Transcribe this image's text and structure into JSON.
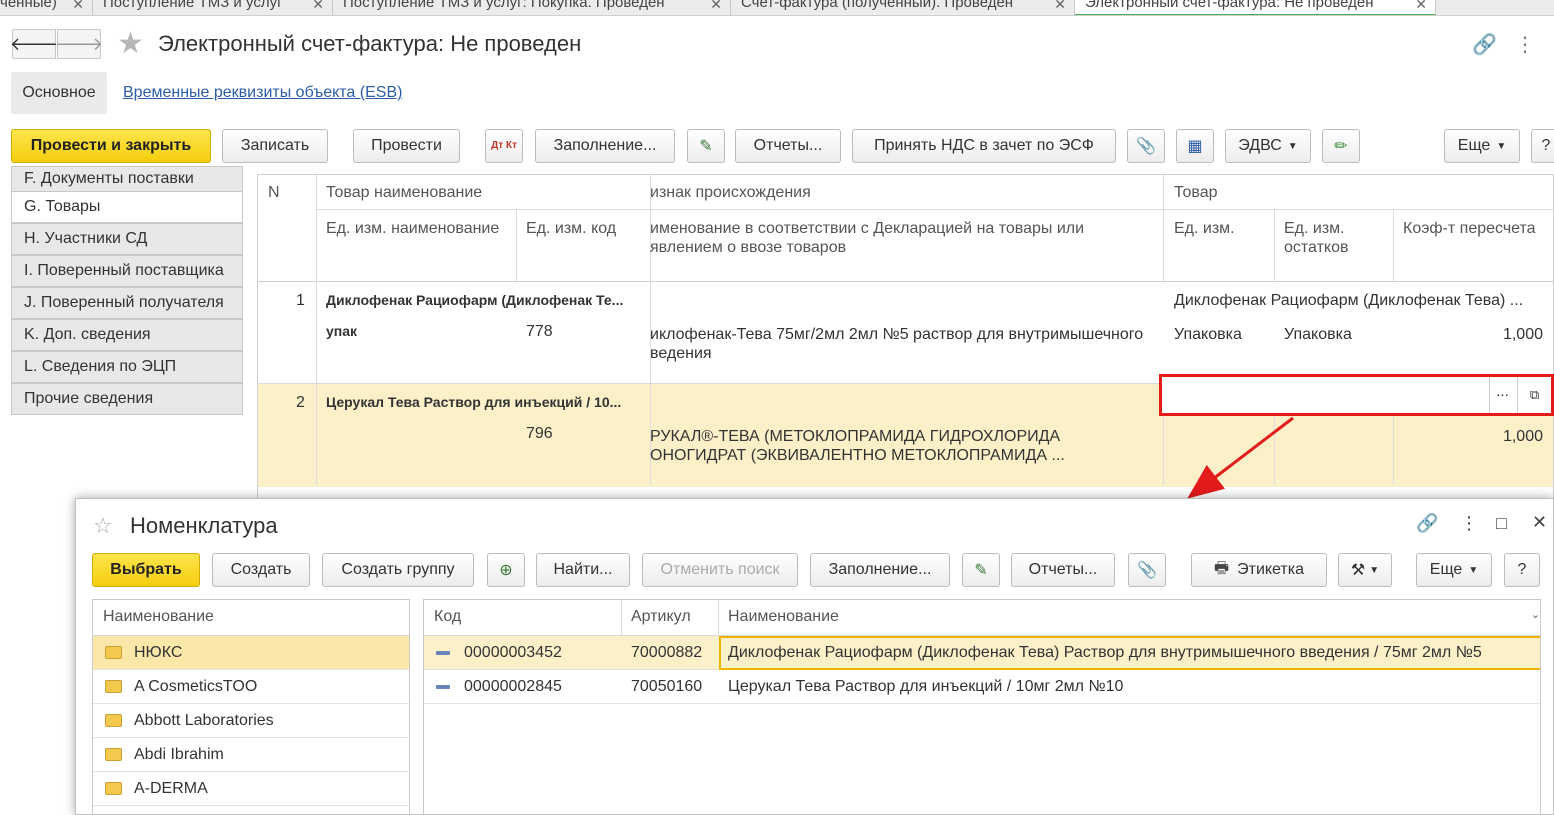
{
  "tabs": [
    {
      "label": "ченные)"
    },
    {
      "label": "Поступление ТМЗ и услуг"
    },
    {
      "label": "Поступление ТМЗ и услуг: Покупка. Проведен"
    },
    {
      "label": "Счет-фактура (полученный). Проведен"
    },
    {
      "label": "Электронный счет-фактура:  Не проведен"
    }
  ],
  "header": {
    "title": "Электронный счет-фактура:  Не проведен",
    "tab_main": "Основное",
    "tab_esb": "Временные реквизиты объекта (ESB)"
  },
  "toolbar": {
    "post_close": "Провести и закрыть",
    "save": "Записать",
    "post": "Провести",
    "dtkt": "Дт Кт",
    "fill": "Заполнение...",
    "reports": "Отчеты...",
    "accept_vat": "Принять НДС в зачет по ЭСФ",
    "edvs": "ЭДВС",
    "more": "Еще",
    "help": "?"
  },
  "side_menu": [
    {
      "label": "F. Документы поставки"
    },
    {
      "label": "G. Товары"
    },
    {
      "label": "H. Участники СД"
    },
    {
      "label": "I. Поверенный поставщика"
    },
    {
      "label": "J. Поверенный получателя"
    },
    {
      "label": "K. Доп. сведения"
    },
    {
      "label": "L. Сведения по ЭЦП"
    },
    {
      "label": "Прочие сведения"
    }
  ],
  "grid": {
    "headers": {
      "n": "N",
      "name": "Товар наименование",
      "origin": "изнак происхождения",
      "product": "Товар",
      "unit_name": "Ед. изм. наименование",
      "unit_code": "Ед. изм. код",
      "decl_name_1": "именование в соответствии с Декларацией  на товары или",
      "decl_name_2": "явлением о ввозе товаров",
      "unit": "Ед. изм.",
      "unit_rest_1": "Ед. изм.",
      "unit_rest_2": "остатков",
      "coef": "Коэф-т пересчета"
    },
    "rows": [
      {
        "n": "1",
        "name": "Диклофенак Рациофарм (Диклофенак Те...",
        "unit_name": "упак",
        "unit_code": "778",
        "decl_1": "иклофенак-Тева 75мг/2мл 2мл №5 раствор для внутримышечного",
        "decl_2": "ведения",
        "product": "Диклофенак Рациофарм (Диклофенак Тева) ...",
        "unit": "Упаковка",
        "unit_rest": "Упаковка",
        "coef": "1,000"
      },
      {
        "n": "2",
        "name": "Церукал Тева Раствор для инъекций / 10...",
        "unit_name": "",
        "unit_code": "796",
        "decl_1": "РУКАЛ®-ТЕВА (МЕТОКЛОПРАМИДА ГИДРОХЛОРИДА",
        "decl_2": "ОНОГИДРАТ (ЭКВИВАЛЕНТНО МЕТОКЛОПРАМИДА ...",
        "product": "",
        "unit": "",
        "unit_rest": "",
        "coef": "1,000"
      }
    ],
    "edit_dots": "..."
  },
  "popup": {
    "title": "Номенклатура",
    "buttons": {
      "select": "Выбрать",
      "create": "Создать",
      "create_group": "Создать группу",
      "find": "Найти...",
      "cancel_search": "Отменить поиск",
      "fill": "Заполнение...",
      "reports": "Отчеты...",
      "label": "Этикетка",
      "more": "Еще",
      "help": "?"
    },
    "tree_header": "Наименование",
    "tree": [
      {
        "label": "НЮКС"
      },
      {
        "label": "A CosmeticsTOO"
      },
      {
        "label": "Abbott Laboratories"
      },
      {
        "label": "Abdi Ibrahim"
      },
      {
        "label": "A-DERMA"
      }
    ],
    "list_headers": {
      "code": "Код",
      "article": "Артикул",
      "name": "Наименование"
    },
    "list": [
      {
        "code": "00000003452",
        "article": "70000882",
        "name": "Диклофенак Рациофарм (Диклофенак Тева) Раствор для внутримышечного введения / 75мг 2мл №5"
      },
      {
        "code": "00000002845",
        "article": "70050160",
        "name": "Церукал Тева Раствор для инъекций / 10мг 2мл №10"
      }
    ]
  },
  "colors": {
    "primary": "#f4ce0d",
    "highlight": "#e31b1b",
    "selection": "#fbf0c8",
    "link": "#2b5da8"
  }
}
